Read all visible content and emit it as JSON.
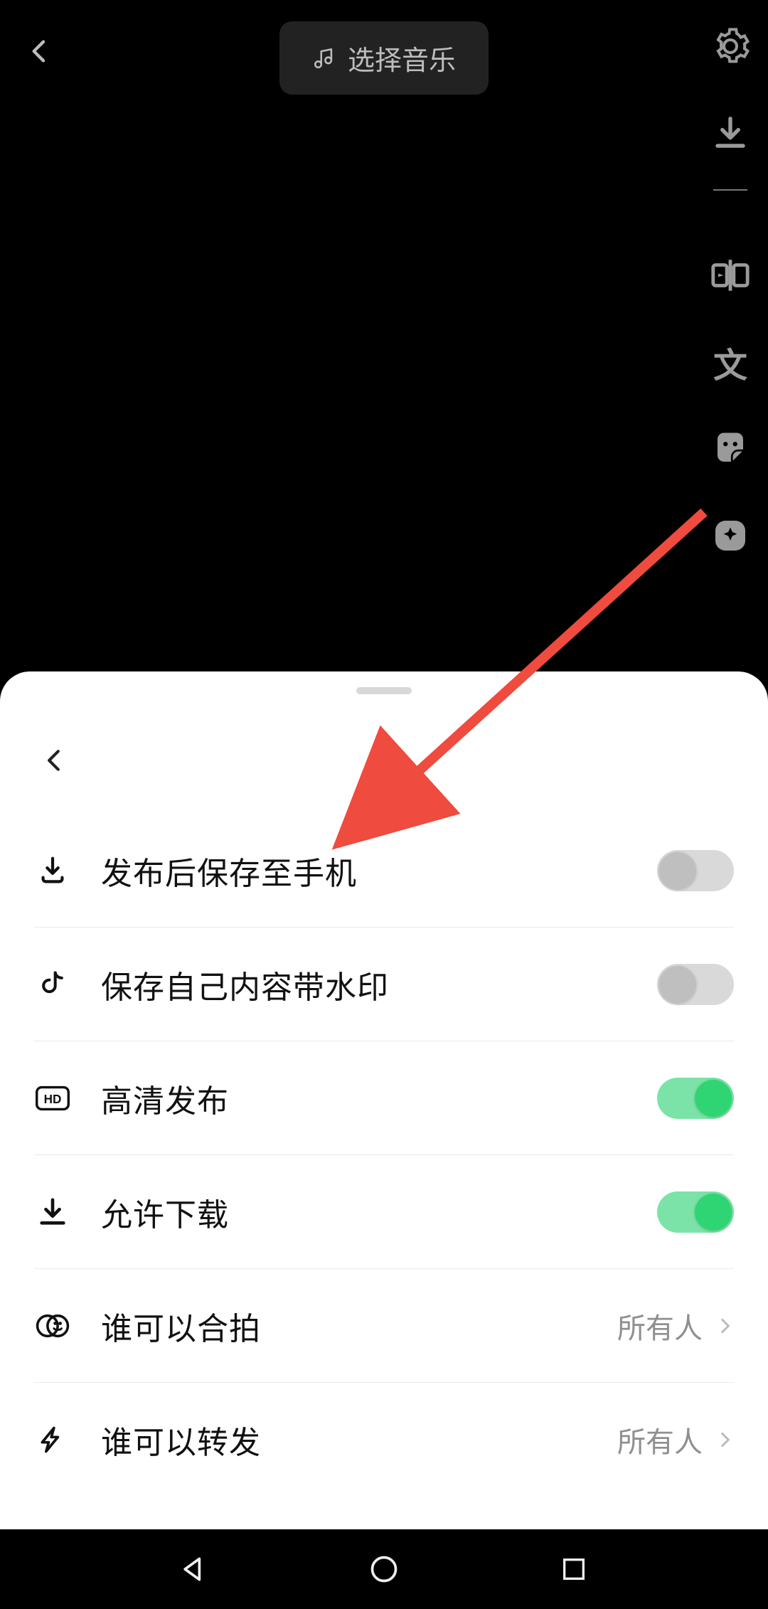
{
  "header": {
    "music_label": "选择音乐"
  },
  "side_tools": {
    "settings": "settings",
    "download": "download",
    "compare": "split",
    "text": "文",
    "sticker": "sticker",
    "effect": "effect"
  },
  "sheet": {
    "rows": [
      {
        "icon": "save-to-phone",
        "label": "发布后保存至手机",
        "type": "toggle",
        "on": false
      },
      {
        "icon": "douyin",
        "label": "保存自己内容带水印",
        "type": "toggle",
        "on": false
      },
      {
        "icon": "hd",
        "label": "高清发布",
        "type": "toggle",
        "on": true
      },
      {
        "icon": "download",
        "label": "允许下载",
        "type": "toggle",
        "on": true
      },
      {
        "icon": "duet",
        "label": "谁可以合拍",
        "type": "link",
        "value": "所有人"
      },
      {
        "icon": "forward",
        "label": "谁可以转发",
        "type": "link",
        "value": "所有人"
      }
    ]
  }
}
